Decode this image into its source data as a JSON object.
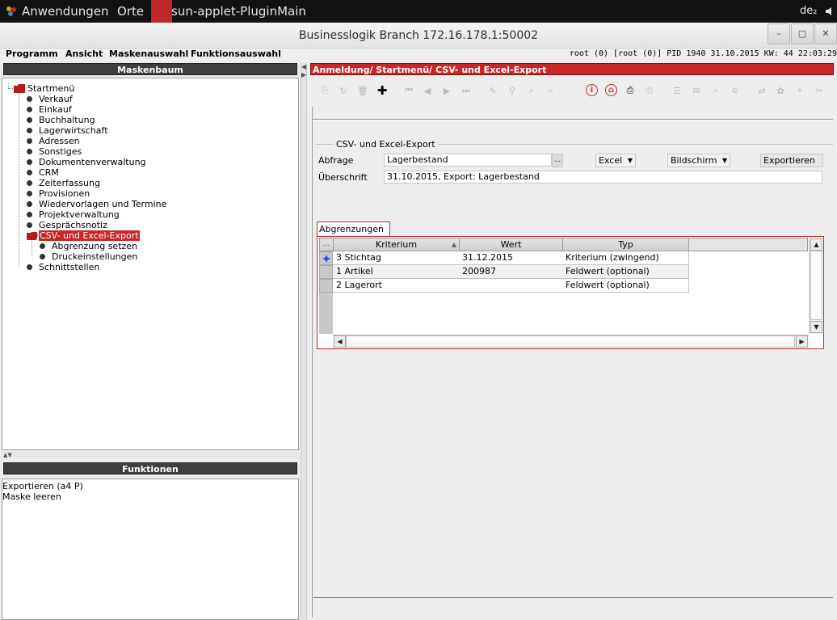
{
  "topbar": {
    "apps_label": "Anwendungen",
    "places_label": "Orte",
    "active_app": "sun-applet-PluginMain",
    "keyboard": "de₂"
  },
  "window": {
    "title": "Businesslogik Branch 172.16.178.1:50002",
    "minimize": "–",
    "maximize": "▢",
    "close": "✕"
  },
  "menu": {
    "items": [
      "Programm",
      "Ansicht",
      "Maskenauswahl",
      "Funktionsauswahl"
    ],
    "status": "root (0) [root (0)] PID 1940  31.10.2015  KW: 44  22:03:29"
  },
  "left": {
    "tree_header": "Maskenbaum",
    "root": "Startmenü",
    "items": [
      "Verkauf",
      "Einkauf",
      "Buchhaltung",
      "Lagerwirtschaft",
      "Adressen",
      "Sonstiges",
      "Dokumentenverwaltung",
      "CRM",
      "Zeiterfassung",
      "Provisionen",
      "Wiedervorlagen und Termine",
      "Projektverwaltung",
      "Gesprächsnotiz",
      "CSV- und Excel-Export",
      "Schnittstellen"
    ],
    "subitems": [
      "Abgrenzung setzen",
      "Druckeinstellungen"
    ],
    "functions_header": "Funktionen",
    "functions": [
      "Exportieren (a4 P)",
      "Maske leeren"
    ]
  },
  "main": {
    "breadcrumb": "Anmeldung/ Startmenü/ CSV- und Excel-Export",
    "group_title": "CSV- und Excel-Export",
    "abfrage_label": "Abfrage",
    "abfrage_value": "Lagerbestand",
    "browse": "...",
    "format_value": "Excel",
    "target_value": "Bildschirm",
    "export_button": "Exportieren",
    "ueberschrift_label": "Überschrift",
    "ueberschrift_value": "31.10.2015, Export: Lagerbestand",
    "tab_label": "Abgrenzungen",
    "table": {
      "corner": "...",
      "columns": [
        "Kriterium",
        "Wert",
        "Typ"
      ],
      "rows": [
        [
          "3 Stichtag",
          "31.12.2015",
          "Kriterium (zwingend)"
        ],
        [
          "1 Artikel",
          "200987",
          "Feldwert (optional)"
        ],
        [
          "2 Lagerort",
          "",
          "Feldwert (optional)"
        ]
      ]
    }
  }
}
